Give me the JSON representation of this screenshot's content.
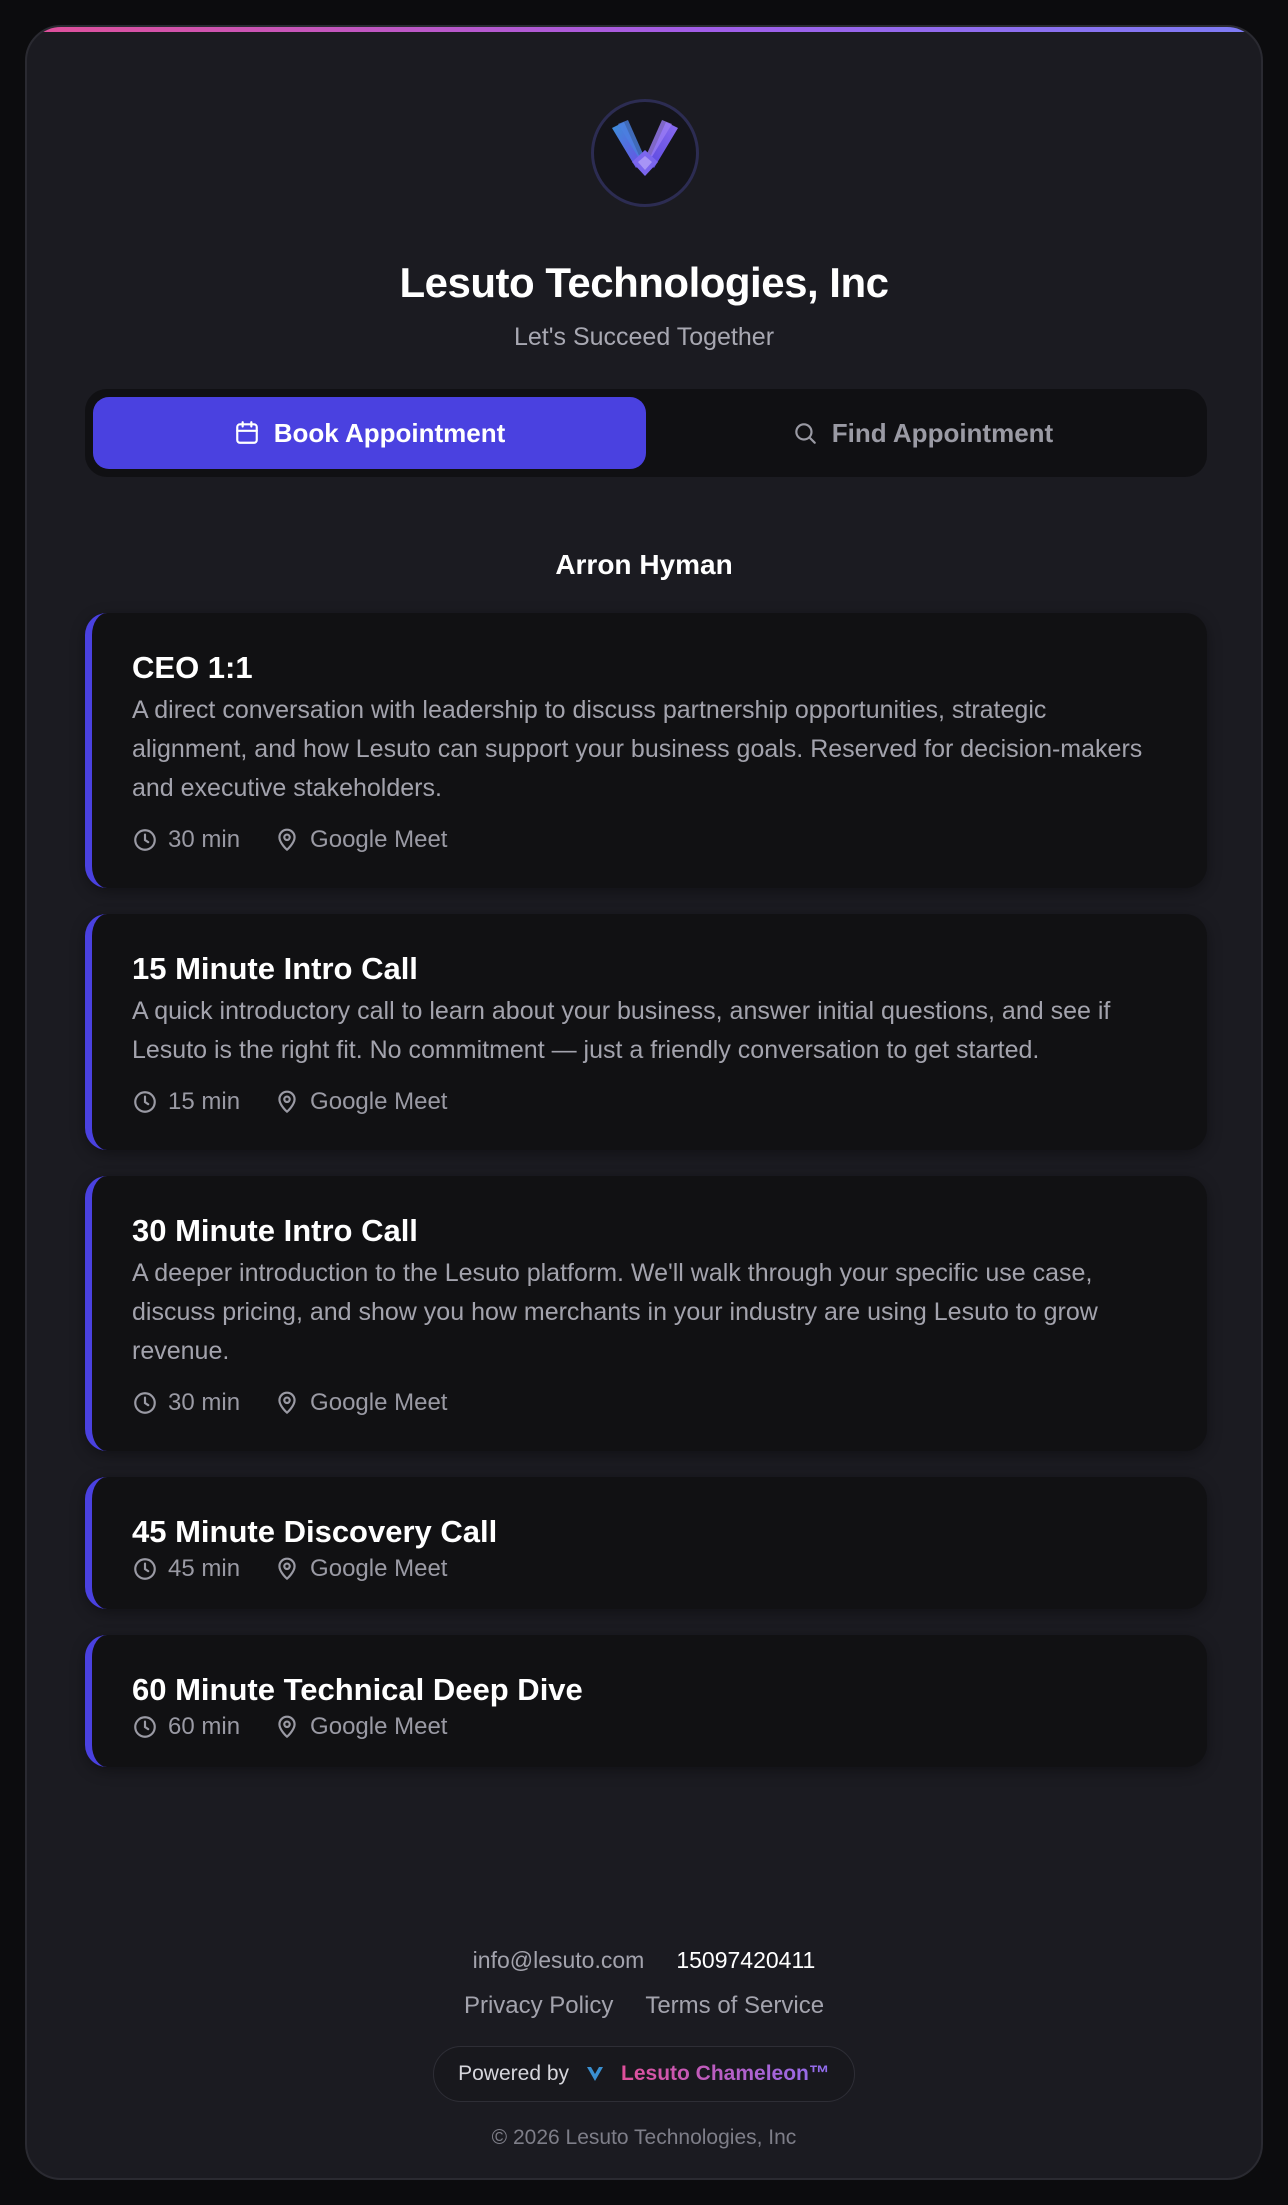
{
  "company": {
    "name": "Lesuto Technologies, Inc",
    "tagline": "Let's Succeed Together"
  },
  "tabs": [
    {
      "label": "Book Appointment",
      "icon": "calendar-icon",
      "active": true
    },
    {
      "label": "Find Appointment",
      "icon": "search-icon",
      "active": false
    }
  ],
  "host": "Arron Hyman",
  "events": [
    {
      "title": "CEO 1:1",
      "description": "A direct conversation with leadership to discuss partnership opportunities, strategic alignment, and how Lesuto can support your business goals. Reserved for decision-makers and executive stakeholders.",
      "duration": "30 min",
      "location": "Google Meet"
    },
    {
      "title": "15 Minute Intro Call",
      "description": "A quick introductory call to learn about your business, answer initial questions, and see if Lesuto is the right fit. No commitment — just a friendly conversation to get started.",
      "duration": "15 min",
      "location": "Google Meet"
    },
    {
      "title": "30 Minute Intro Call",
      "description": "A deeper introduction to the Lesuto platform. We'll walk through your specific use case, discuss pricing, and show you how merchants in your industry are using Lesuto to grow revenue.",
      "duration": "30 min",
      "location": "Google Meet"
    },
    {
      "title": "45 Minute Discovery Call",
      "description": "",
      "duration": "45 min",
      "location": "Google Meet"
    },
    {
      "title": "60 Minute Technical Deep Dive",
      "description": "",
      "duration": "60 min",
      "location": "Google Meet"
    }
  ],
  "footer": {
    "email": "info@lesuto.com",
    "phone": "15097420411",
    "privacy": "Privacy Policy",
    "terms": "Terms of Service",
    "powered_by": "Powered by",
    "brand": "Lesuto Chameleon™",
    "copyright": "© 2026 Lesuto Technologies, Inc"
  },
  "colors": {
    "accent": "#4a41e0",
    "background": "#1b1b21",
    "card": "#111113",
    "gradient_start": "#e0509a",
    "gradient_end": "#7d7cf5"
  }
}
